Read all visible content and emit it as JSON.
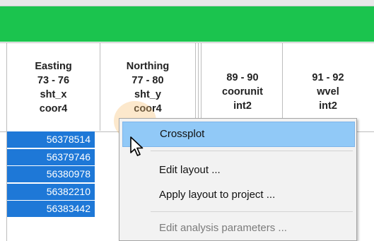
{
  "table": {
    "headers": [
      {
        "lines": [
          "Easting",
          "73 - 76",
          "sht_x",
          "coor4"
        ]
      },
      {
        "lines": [
          "Northing",
          "77 - 80",
          "sht_y",
          "coor4"
        ]
      },
      {
        "lines": [
          "89 - 90",
          "coorunit",
          "int2"
        ]
      },
      {
        "lines": [
          "91 - 92",
          "wvel",
          "int2"
        ]
      }
    ],
    "easting_values": [
      "56378514",
      "56379746",
      "56380978",
      "56382210",
      "56383442"
    ]
  },
  "context_menu": {
    "items": [
      {
        "label": "Crossplot",
        "state": "highlighted"
      },
      {
        "label": "Edit layout ...",
        "state": "enabled"
      },
      {
        "label": "Apply layout to project ...",
        "state": "enabled"
      },
      {
        "label": "Edit analysis parameters ...",
        "state": "disabled"
      }
    ]
  },
  "colors": {
    "title_bar": "#1bc44e",
    "selected_cell": "#1e78d7",
    "menu_highlight": "#91c9f7",
    "menu_background": "#f2f2f2"
  }
}
